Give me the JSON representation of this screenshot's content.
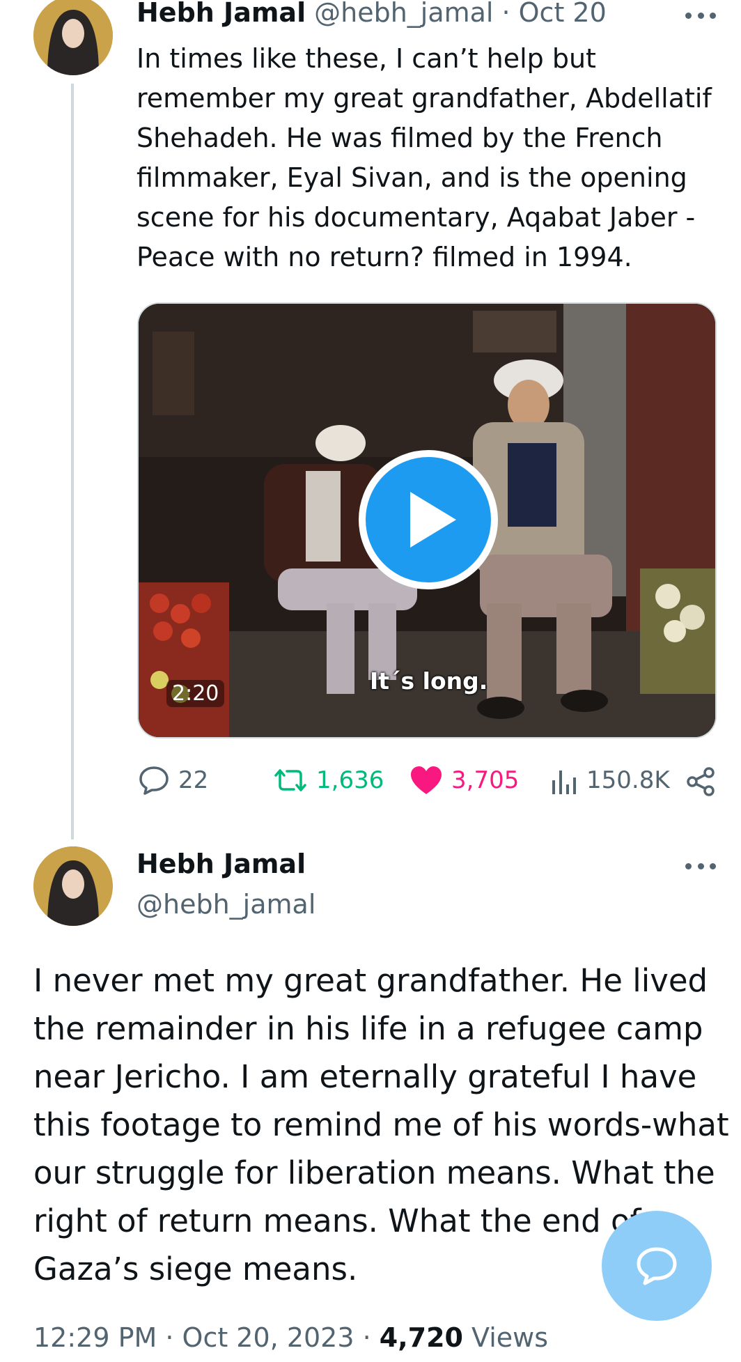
{
  "tweet1": {
    "author_name": "Hebh Jamal",
    "author_handle": "@hebh_jamal",
    "date": "· Oct 20",
    "text_lines": [
      "In times like these, I can’t help but",
      "remember my great grandfather, Abdellatif",
      "Shehadeh. He was filmed by the French",
      "filmmaker, Eyal Sivan, and is the opening",
      "scene for his documentary, Aqabat Jaber -",
      "Peace with no return? filmed in 1994."
    ],
    "video": {
      "duration": "2:20",
      "subtitle": "It´s long."
    },
    "actions": {
      "replies": "22",
      "retweets": "1,636",
      "likes": "3,705",
      "views": "150.8K"
    }
  },
  "tweet2": {
    "author_name": "Hebh Jamal",
    "author_handle": "@hebh_jamal",
    "text_lines": [
      "I never met my great grandfather. He lived",
      "the remainder in his life in a refugee camp",
      "near Jericho. I am eternally grateful I have",
      "this footage to remind me of his words-what",
      "our struggle for liberation means. What the",
      "right of return means. What the end of",
      "Gaza’s siege means."
    ],
    "timestamp": "12:29 PM · Oct 20, 2023 · ",
    "views_count": "4,720",
    "views_label": " Views"
  },
  "icons": {
    "reply": "speech-bubble-icon",
    "retweet": "retweet-icon",
    "like": "heart-icon",
    "views": "bar-chart-icon",
    "share": "share-icon",
    "more": "more-dots-icon",
    "compose": "compose-reply-icon"
  },
  "colors": {
    "retweet_green": "#00ba7c",
    "like_pink": "#f91880",
    "brand_blue": "#1d9bf0",
    "fab_blue": "#8ecdf8"
  }
}
